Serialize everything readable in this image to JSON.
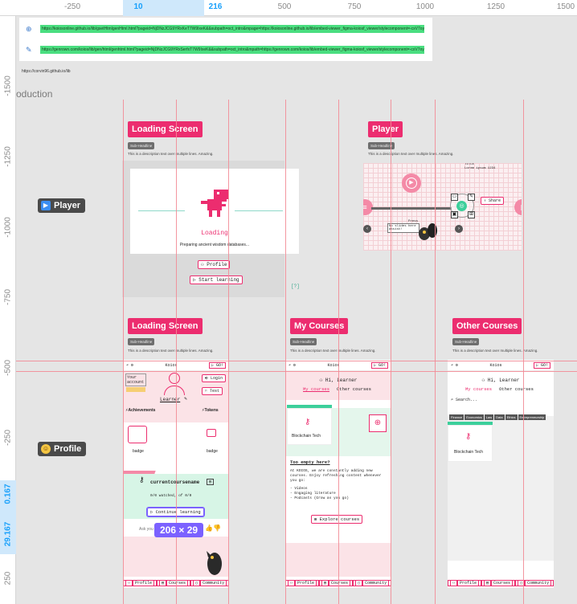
{
  "ruler": {
    "top_ticks": [
      "-250",
      "10",
      "216",
      "500",
      "750",
      "1000",
      "1250",
      "1500"
    ],
    "left_ticks": [
      "-1500",
      "-1250",
      "-1000",
      "-750",
      "-500",
      "-250",
      "0.167",
      "29.167",
      "250"
    ]
  },
  "links": {
    "row1": "https://koiosonline.github.io/lib/gsetHtmlgenHtml.html?pageid=NjDNzJCG9YRxKeT7W9IxeK&&subpath=oct_intro&mpage=https://koiosonline.github.io/lib/embed-viewer_figma-koiosf_viewer/stylecomponent=-cxV7oyzw4bAn8mqRtSdq",
    "row2": "https://genrown.com/koios/lib/gen/html/genhtml.html?pageid=NjDNzJCG9YRxSerfxT7W9IxeK&&subpath=oct_intro&mpath=https://genrown.com/koios/lib/embed-viewer_figma-koiosf_viewer/stylecomponent=-cxV7oyzw4bAn8mqRtSdq",
    "site": "https://corvin96.github.io/lib"
  },
  "section_label": "oduction",
  "rows": {
    "player": "Player",
    "profile": "Profile"
  },
  "loading_top": {
    "title": "Loading Screen",
    "chip": "Sub-Headline",
    "desc": "This is a description text over multiple lines. Amazing.",
    "loading_text": "Loading",
    "sub_text": "Preparing ancient wisdom databases...",
    "profile_btn": "Profile",
    "start_btn": "Start learning",
    "corner": "[?]"
  },
  "player": {
    "title": "Player",
    "chip": "Sub-Headline",
    "desc": "This is a description text over multiple lines. Amazing.",
    "meta_title": "TITLE",
    "meta_value": "Lorem ipsum 1234",
    "share": "Share",
    "bubble": "No slides here assist!",
    "label": "Press"
  },
  "loading_profile": {
    "title": "Loading Screen",
    "chip": "Sub-Headline",
    "desc": "This is a description text over multiple lines. Amazing.",
    "brand": "Koios",
    "go": "GO!",
    "your_account": "Your account",
    "login": "Login",
    "test": "Test",
    "learner": "Learner",
    "achievements": "Achievements",
    "tokens": "Tokens",
    "badge": "badge",
    "badge2": "badge",
    "course": "currentcoursename",
    "watched": "0/0 watched, of 0/0",
    "continue": "Continue learning",
    "ask": "Ask you"
  },
  "my_courses": {
    "title": "My Courses",
    "chip": "Sub-Headline",
    "desc": "This is a description text over multiple lines. Amazing.",
    "brand": "Koios",
    "go": "GO!",
    "greeting": "Hi, Learner",
    "tab_mine": "My courses",
    "tab_other": "Other courses",
    "card": "Blockchain Tech",
    "empty_title": "Too empty here?",
    "empty_body": "At KOIOS, we are constantly adding new courses. Enjoy refreshing content whenever you go:",
    "list": [
      "- Videos",
      "- Engaging literature",
      "- Podcasts (Grow as you go)"
    ],
    "explore": "Explore courses"
  },
  "other_courses": {
    "title": "Other Courses",
    "chip": "Sub-Headline",
    "desc": "This is a description text over multiple lines. Amazing.",
    "brand": "Koios",
    "go": "GO!",
    "greeting": "Hi, Learner",
    "tab_mine": "My courses",
    "tab_other": "Other courses",
    "search": "Search...",
    "tags": [
      "Finance",
      "Economics",
      "Law",
      "Data",
      "Ethics",
      "Entrepreneurship"
    ],
    "card": "Blockchain Tech"
  },
  "nav": {
    "profile": "Profile",
    "courses": "Courses",
    "community": "Community"
  },
  "dimension_badge": "206 × 29",
  "colors": {
    "accent": "#ec2d6f",
    "guide": "#f28b96",
    "selection": "#7b61ff",
    "link_highlight": "#4ade80"
  }
}
